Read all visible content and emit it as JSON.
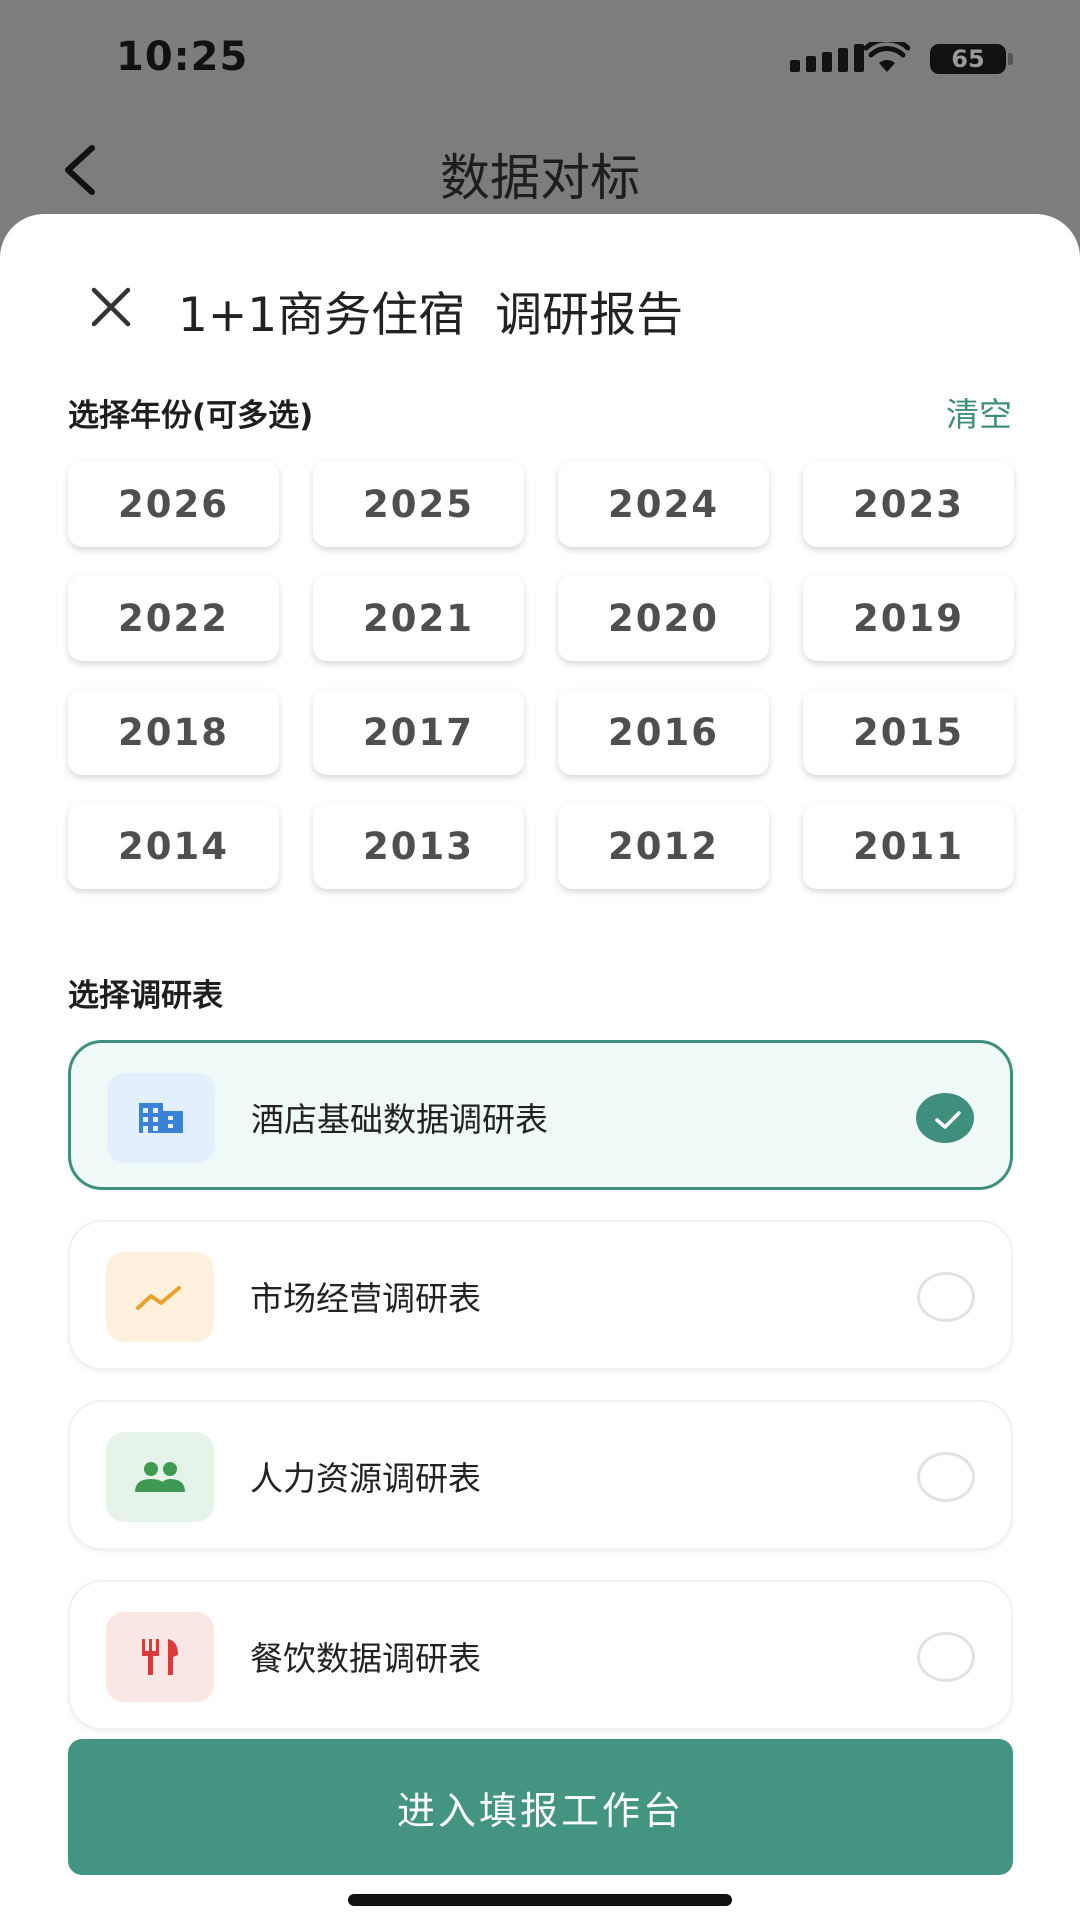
{
  "status_bar": {
    "time": "10:25",
    "battery": "65"
  },
  "nav": {
    "title": "数据对标"
  },
  "sheet": {
    "title": "1+1商务住宿  调研报告",
    "year_section": {
      "label": "选择年份(可多选)",
      "clear_label": "清空",
      "years": [
        "2026",
        "2025",
        "2024",
        "2023",
        "2022",
        "2021",
        "2020",
        "2019",
        "2018",
        "2017",
        "2016",
        "2015",
        "2014",
        "2013",
        "2012",
        "2011"
      ]
    },
    "survey_section": {
      "label": "选择调研表",
      "items": [
        {
          "name": "酒店基础数据调研表",
          "icon": "building-icon",
          "selected": true
        },
        {
          "name": "市场经营调研表",
          "icon": "trend-chart-icon",
          "selected": false
        },
        {
          "name": "人力资源调研表",
          "icon": "people-icon",
          "selected": false
        },
        {
          "name": "餐饮数据调研表",
          "icon": "fork-knife-icon",
          "selected": false
        }
      ]
    },
    "submit_label": "进入填报工作台"
  },
  "colors": {
    "accent": "#449482",
    "selected_bg": "#effaf8",
    "overlay": "#7d7d7d"
  }
}
